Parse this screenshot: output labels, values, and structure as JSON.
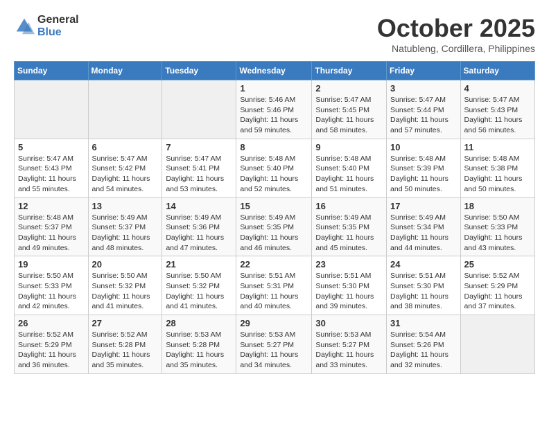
{
  "header": {
    "logo_line1": "General",
    "logo_line2": "Blue",
    "month": "October 2025",
    "location": "Natubleng, Cordillera, Philippines"
  },
  "weekdays": [
    "Sunday",
    "Monday",
    "Tuesday",
    "Wednesday",
    "Thursday",
    "Friday",
    "Saturday"
  ],
  "weeks": [
    [
      {
        "day": "",
        "sunrise": "",
        "sunset": "",
        "daylight": ""
      },
      {
        "day": "",
        "sunrise": "",
        "sunset": "",
        "daylight": ""
      },
      {
        "day": "",
        "sunrise": "",
        "sunset": "",
        "daylight": ""
      },
      {
        "day": "1",
        "sunrise": "Sunrise: 5:46 AM",
        "sunset": "Sunset: 5:46 PM",
        "daylight": "Daylight: 11 hours and 59 minutes."
      },
      {
        "day": "2",
        "sunrise": "Sunrise: 5:47 AM",
        "sunset": "Sunset: 5:45 PM",
        "daylight": "Daylight: 11 hours and 58 minutes."
      },
      {
        "day": "3",
        "sunrise": "Sunrise: 5:47 AM",
        "sunset": "Sunset: 5:44 PM",
        "daylight": "Daylight: 11 hours and 57 minutes."
      },
      {
        "day": "4",
        "sunrise": "Sunrise: 5:47 AM",
        "sunset": "Sunset: 5:43 PM",
        "daylight": "Daylight: 11 hours and 56 minutes."
      }
    ],
    [
      {
        "day": "5",
        "sunrise": "Sunrise: 5:47 AM",
        "sunset": "Sunset: 5:43 PM",
        "daylight": "Daylight: 11 hours and 55 minutes."
      },
      {
        "day": "6",
        "sunrise": "Sunrise: 5:47 AM",
        "sunset": "Sunset: 5:42 PM",
        "daylight": "Daylight: 11 hours and 54 minutes."
      },
      {
        "day": "7",
        "sunrise": "Sunrise: 5:47 AM",
        "sunset": "Sunset: 5:41 PM",
        "daylight": "Daylight: 11 hours and 53 minutes."
      },
      {
        "day": "8",
        "sunrise": "Sunrise: 5:48 AM",
        "sunset": "Sunset: 5:40 PM",
        "daylight": "Daylight: 11 hours and 52 minutes."
      },
      {
        "day": "9",
        "sunrise": "Sunrise: 5:48 AM",
        "sunset": "Sunset: 5:40 PM",
        "daylight": "Daylight: 11 hours and 51 minutes."
      },
      {
        "day": "10",
        "sunrise": "Sunrise: 5:48 AM",
        "sunset": "Sunset: 5:39 PM",
        "daylight": "Daylight: 11 hours and 50 minutes."
      },
      {
        "day": "11",
        "sunrise": "Sunrise: 5:48 AM",
        "sunset": "Sunset: 5:38 PM",
        "daylight": "Daylight: 11 hours and 50 minutes."
      }
    ],
    [
      {
        "day": "12",
        "sunrise": "Sunrise: 5:48 AM",
        "sunset": "Sunset: 5:37 PM",
        "daylight": "Daylight: 11 hours and 49 minutes."
      },
      {
        "day": "13",
        "sunrise": "Sunrise: 5:49 AM",
        "sunset": "Sunset: 5:37 PM",
        "daylight": "Daylight: 11 hours and 48 minutes."
      },
      {
        "day": "14",
        "sunrise": "Sunrise: 5:49 AM",
        "sunset": "Sunset: 5:36 PM",
        "daylight": "Daylight: 11 hours and 47 minutes."
      },
      {
        "day": "15",
        "sunrise": "Sunrise: 5:49 AM",
        "sunset": "Sunset: 5:35 PM",
        "daylight": "Daylight: 11 hours and 46 minutes."
      },
      {
        "day": "16",
        "sunrise": "Sunrise: 5:49 AM",
        "sunset": "Sunset: 5:35 PM",
        "daylight": "Daylight: 11 hours and 45 minutes."
      },
      {
        "day": "17",
        "sunrise": "Sunrise: 5:49 AM",
        "sunset": "Sunset: 5:34 PM",
        "daylight": "Daylight: 11 hours and 44 minutes."
      },
      {
        "day": "18",
        "sunrise": "Sunrise: 5:50 AM",
        "sunset": "Sunset: 5:33 PM",
        "daylight": "Daylight: 11 hours and 43 minutes."
      }
    ],
    [
      {
        "day": "19",
        "sunrise": "Sunrise: 5:50 AM",
        "sunset": "Sunset: 5:33 PM",
        "daylight": "Daylight: 11 hours and 42 minutes."
      },
      {
        "day": "20",
        "sunrise": "Sunrise: 5:50 AM",
        "sunset": "Sunset: 5:32 PM",
        "daylight": "Daylight: 11 hours and 41 minutes."
      },
      {
        "day": "21",
        "sunrise": "Sunrise: 5:50 AM",
        "sunset": "Sunset: 5:32 PM",
        "daylight": "Daylight: 11 hours and 41 minutes."
      },
      {
        "day": "22",
        "sunrise": "Sunrise: 5:51 AM",
        "sunset": "Sunset: 5:31 PM",
        "daylight": "Daylight: 11 hours and 40 minutes."
      },
      {
        "day": "23",
        "sunrise": "Sunrise: 5:51 AM",
        "sunset": "Sunset: 5:30 PM",
        "daylight": "Daylight: 11 hours and 39 minutes."
      },
      {
        "day": "24",
        "sunrise": "Sunrise: 5:51 AM",
        "sunset": "Sunset: 5:30 PM",
        "daylight": "Daylight: 11 hours and 38 minutes."
      },
      {
        "day": "25",
        "sunrise": "Sunrise: 5:52 AM",
        "sunset": "Sunset: 5:29 PM",
        "daylight": "Daylight: 11 hours and 37 minutes."
      }
    ],
    [
      {
        "day": "26",
        "sunrise": "Sunrise: 5:52 AM",
        "sunset": "Sunset: 5:29 PM",
        "daylight": "Daylight: 11 hours and 36 minutes."
      },
      {
        "day": "27",
        "sunrise": "Sunrise: 5:52 AM",
        "sunset": "Sunset: 5:28 PM",
        "daylight": "Daylight: 11 hours and 35 minutes."
      },
      {
        "day": "28",
        "sunrise": "Sunrise: 5:53 AM",
        "sunset": "Sunset: 5:28 PM",
        "daylight": "Daylight: 11 hours and 35 minutes."
      },
      {
        "day": "29",
        "sunrise": "Sunrise: 5:53 AM",
        "sunset": "Sunset: 5:27 PM",
        "daylight": "Daylight: 11 hours and 34 minutes."
      },
      {
        "day": "30",
        "sunrise": "Sunrise: 5:53 AM",
        "sunset": "Sunset: 5:27 PM",
        "daylight": "Daylight: 11 hours and 33 minutes."
      },
      {
        "day": "31",
        "sunrise": "Sunrise: 5:54 AM",
        "sunset": "Sunset: 5:26 PM",
        "daylight": "Daylight: 11 hours and 32 minutes."
      },
      {
        "day": "",
        "sunrise": "",
        "sunset": "",
        "daylight": ""
      }
    ]
  ]
}
